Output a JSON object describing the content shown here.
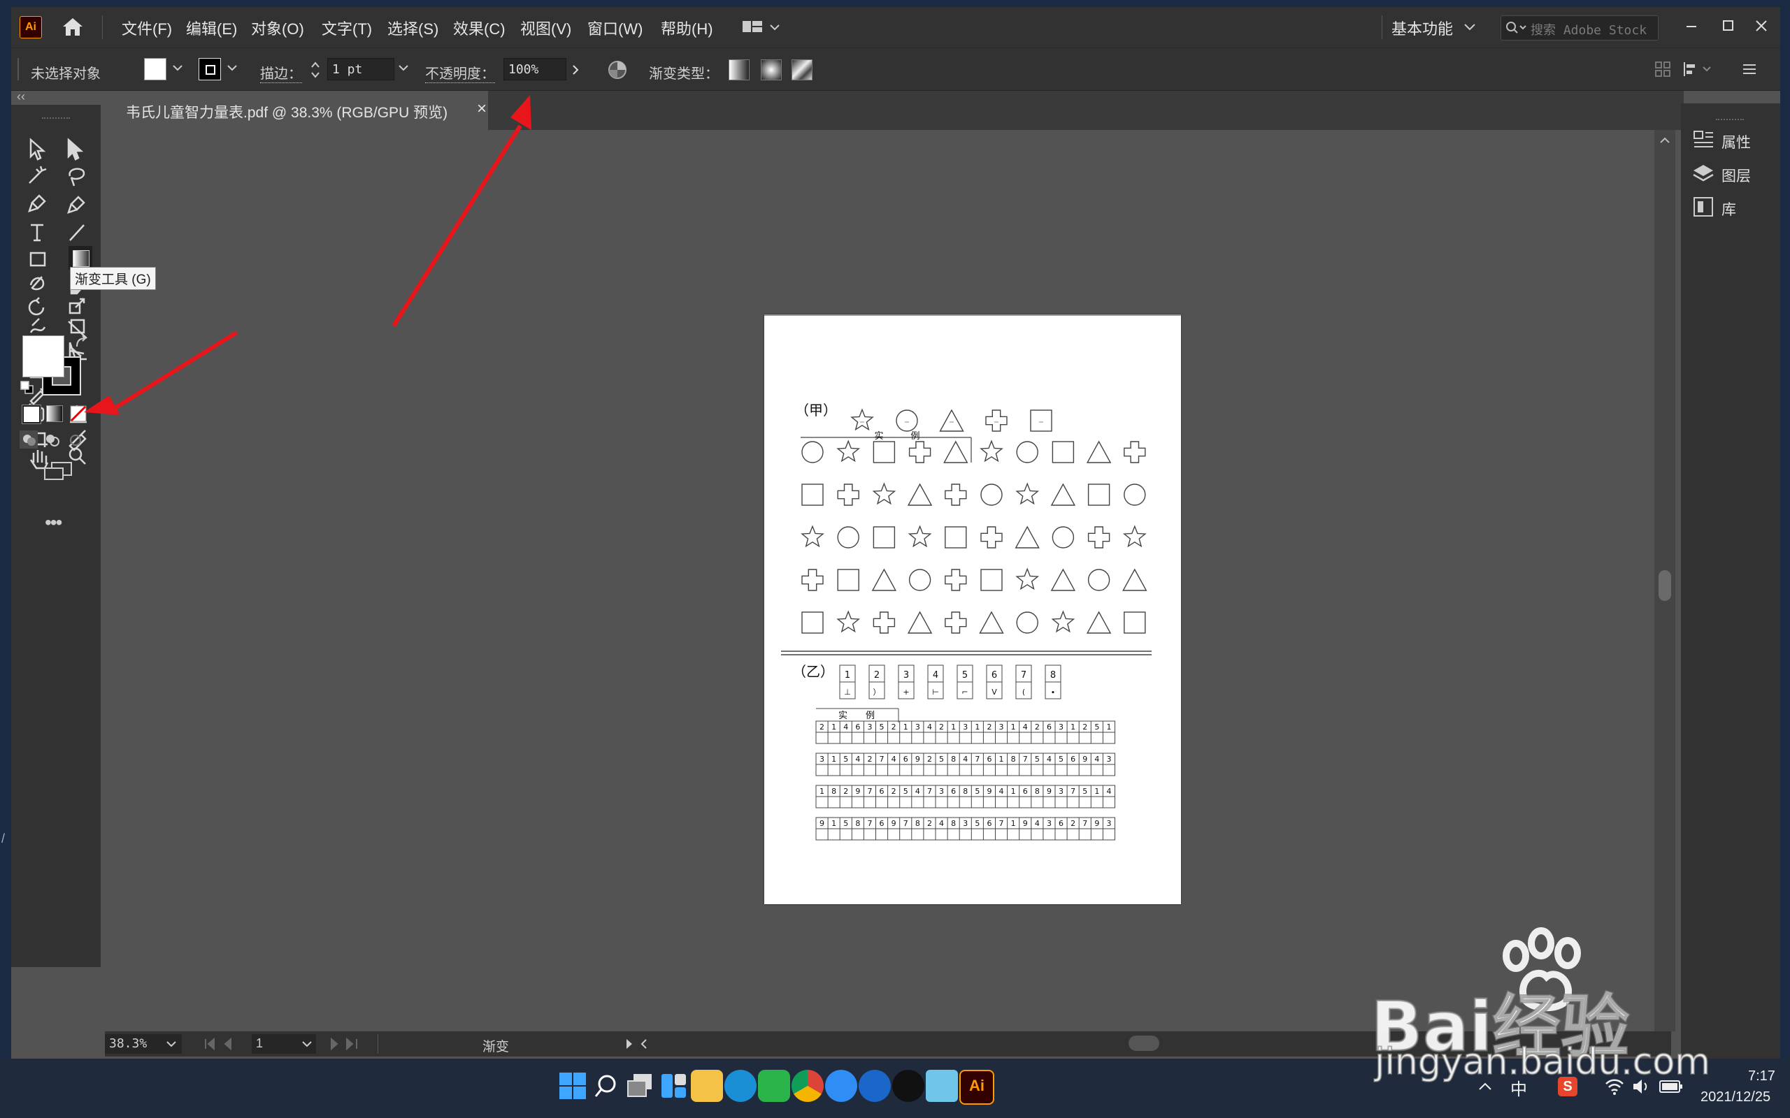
{
  "app": {
    "logo": "Ai"
  },
  "menu": [
    "文件(F)",
    "编辑(E)",
    "对象(O)",
    "文字(T)",
    "选择(S)",
    "效果(C)",
    "视图(V)",
    "窗口(W)",
    "帮助(H)"
  ],
  "workspace": "基本功能",
  "search_placeholder": "搜索 Adobe Stock",
  "control": {
    "selection": "未选择对象",
    "stroke_label": "描边：",
    "stroke_value": "1 pt",
    "opacity_label": "不透明度：",
    "opacity_value": "100%",
    "gradient_type_label": "渐变类型："
  },
  "document_tab": {
    "title": "韦氏儿童智力量表.pdf @ 38.3% (RGB/GPU 预览)",
    "close": "×"
  },
  "tooltip": "渐变工具 (G)",
  "right_panel": [
    {
      "label": "属性",
      "icon": "properties-icon"
    },
    {
      "label": "图层",
      "icon": "layers-icon"
    },
    {
      "label": "库",
      "icon": "libraries-icon"
    }
  ],
  "status": {
    "zoom": "38.3%",
    "page": "1",
    "tool_name": "渐变"
  },
  "artboard": {
    "section_a": "（甲）",
    "section_b": "（乙）",
    "example_a": "实　　　例",
    "example_b": "实　　例",
    "shape_rows": [
      [
        "circle",
        "star",
        "square",
        "cross",
        "triangle",
        "star",
        "circle",
        "square",
        "triangle",
        "cross"
      ],
      [
        "square",
        "cross",
        "star",
        "triangle",
        "cross",
        "circle",
        "star",
        "triangle",
        "square",
        "circle"
      ],
      [
        "star",
        "circle",
        "square",
        "star",
        "square",
        "cross",
        "triangle",
        "circle",
        "cross",
        "star"
      ],
      [
        "cross",
        "square",
        "triangle",
        "circle",
        "cross",
        "square",
        "star",
        "triangle",
        "circle",
        "triangle"
      ],
      [
        "square",
        "star",
        "cross",
        "triangle",
        "cross",
        "triangle",
        "circle",
        "star",
        "triangle",
        "square"
      ]
    ],
    "key_numbers": [
      "1",
      "2",
      "3",
      "4",
      "5",
      "6",
      "7",
      "8"
    ],
    "key_symbols": [
      "⊥",
      "）",
      "+",
      "⊢",
      "⌐",
      "V",
      "(",
      "∙"
    ],
    "digit_rows": [
      "2146352134213123142631251",
      "3154274692584761875456943",
      "1829762547368594168937514",
      "9158769782483567194362793"
    ]
  },
  "taskbar": {
    "icons": [
      "windows-start-icon",
      "search-icon",
      "task-view-icon",
      "widgets-icon",
      "file-explorer-icon",
      "edge-icon",
      "wechat-icon",
      "chrome-icon",
      "feishu-icon",
      "onedrive-icon",
      "qq-icon",
      "notepad-icon",
      "illustrator-icon"
    ],
    "ime": "中",
    "time": "7:17",
    "date": "2021/12/25"
  },
  "watermark": {
    "brand": "Bai经验",
    "url": "jingyan.baidu.com"
  },
  "colors": {
    "arrow": "#e8161b",
    "ai_orange": "#ff9a00",
    "ai_bg": "#330000"
  }
}
